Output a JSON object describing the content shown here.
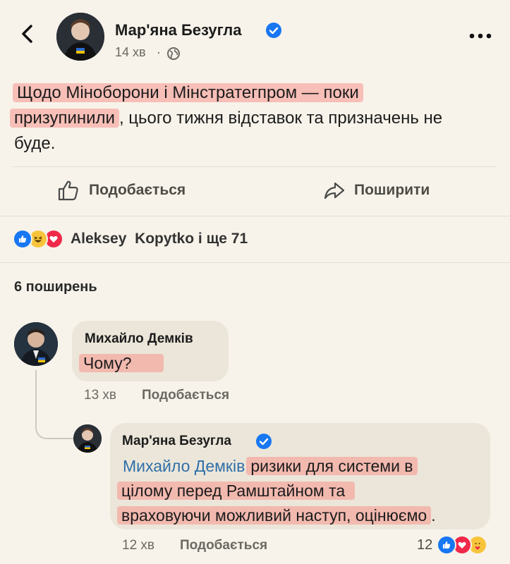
{
  "post": {
    "author": "Мар'яна Безугла",
    "time": "14 хв",
    "separator": "·",
    "text_highlight_1": "Щодо Міноборони і Мінстратегпром — поки",
    "text_highlight_2": "призупинили",
    "text_rest_1": ", цього тижня відставок та призначень не",
    "text_rest_2": "буде."
  },
  "actions": {
    "like": "Подобається",
    "share": "Поширити"
  },
  "reactions": {
    "summary": "Aleksey  Kopytko і ще 71"
  },
  "shares": {
    "label": "6 поширень"
  },
  "comments": [
    {
      "author": "Михайло Демків",
      "text": "Чому?",
      "time": "13 хв",
      "like": "Подобається"
    },
    {
      "author": "Мар'яна Безугла",
      "mention": "Михайло Демків",
      "text_1": "ризики для системи в",
      "text_2": "цілому перед Рамштайном та",
      "text_3": "враховуючи можливий наступ, оцінюємо",
      "text_end": ".",
      "time": "12 хв",
      "like": "Подобається",
      "reaction_count": "12"
    }
  ],
  "colors": {
    "background": "#f7f3ea",
    "verified": "#1877f2",
    "mention": "#2f6fa8",
    "highlight": "#f7948c"
  }
}
